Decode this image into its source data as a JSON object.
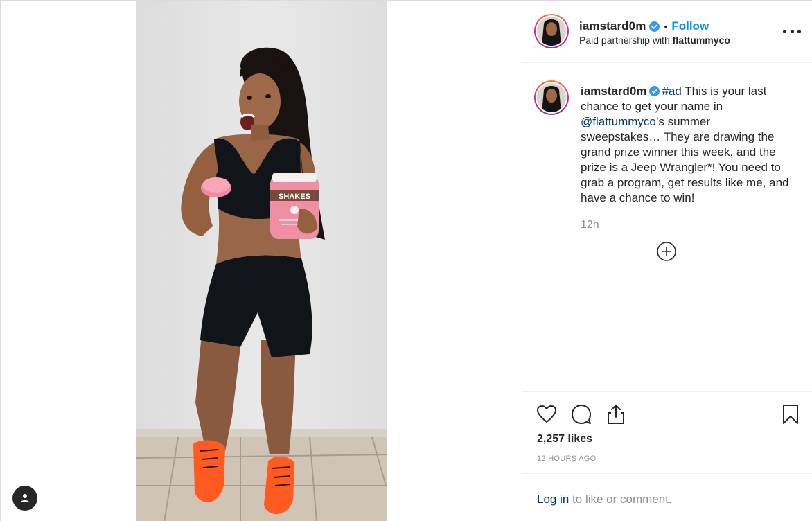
{
  "post": {
    "username": "iamstard0m",
    "follow_label": "Follow",
    "dot": "•",
    "partnership_prefix": "Paid partnership with ",
    "partner": "flattummyco"
  },
  "caption": {
    "username": "iamstard0m",
    "hashtag": "#ad",
    "text_1": " This is your last chance to get your name in ",
    "mention": "@flattummyco",
    "text_2": "’s summer sweepstakes… They are drawing the grand prize winner this week, and the prize is a Jeep Wrangler*! You need to grab a program, get results like me, and have a chance to win!",
    "time": "12h"
  },
  "engagement": {
    "likes": "2,257 likes",
    "posted": "12 HOURS AGO"
  },
  "login": {
    "link": "Log in",
    "rest": " to like or comment."
  },
  "icons": {
    "verified": "verified-badge-icon",
    "more": "more-options-icon",
    "load_more": "plus-circle-icon",
    "like": "heart-icon",
    "comment": "comment-bubble-icon",
    "share": "share-icon",
    "save": "bookmark-icon",
    "user_tag": "user-tag-icon"
  },
  "colors": {
    "accent": "#0095f6",
    "link": "#00376b",
    "muted": "#8e8e8e",
    "text": "#262626",
    "border": "#efefef"
  },
  "product": {
    "label": "SHAKES"
  }
}
